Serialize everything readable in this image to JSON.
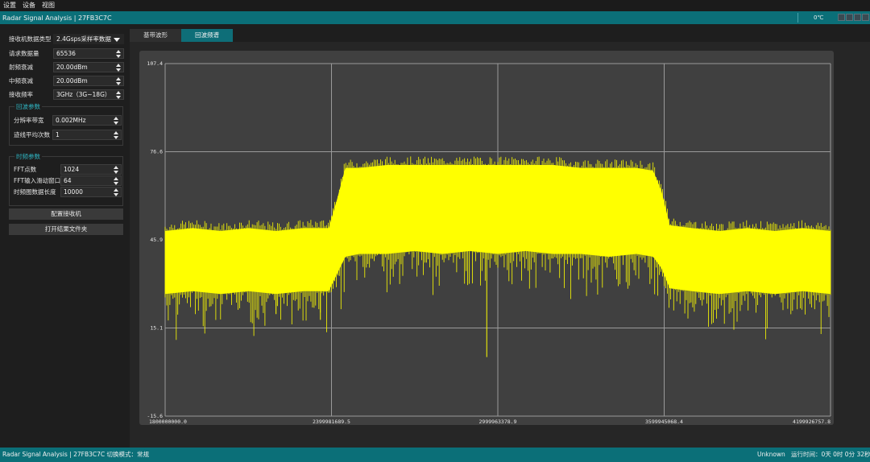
{
  "menubar": {
    "items": [
      "设置",
      "设备",
      "视图"
    ]
  },
  "titlebar": {
    "title": "Radar Signal Analysis | 27FB3C7C",
    "temp": "0℃"
  },
  "left": {
    "data_type": {
      "label": "接收机数据类型",
      "value": "2.4Gsps采样率数据"
    },
    "req_count": {
      "label": "请求数据量",
      "value": "65536"
    },
    "rf_atten": {
      "label": "射频衰减",
      "value": "20.00dBm"
    },
    "if_atten": {
      "label": "中频衰减",
      "value": "20.00dBm"
    },
    "rx_freq": {
      "label": "接收频率",
      "value": "3GHz（3G~18G）"
    },
    "echo_group": {
      "title": "回波参数",
      "rbw": {
        "label": "分辨率带宽",
        "value": "0.002MHz"
      },
      "avg": {
        "label": "迹线平均次数",
        "value": "1"
      }
    },
    "tf_group": {
      "title": "时频参数",
      "fft": {
        "label": "FFT点数",
        "value": "1024"
      },
      "win": {
        "label": "FFT输入滑动窗口",
        "value": "64"
      },
      "len": {
        "label": "时频图数据长度",
        "value": "10000"
      }
    },
    "btn_config": "配置接收机",
    "btn_open": "打开结果文件夹"
  },
  "tabs": [
    "基带波形",
    "回波频谱"
  ],
  "chart_data": {
    "type": "line",
    "title": "",
    "xlabel": "",
    "ylabel": "",
    "xlim": [
      1800000000.0,
      4199926757.8
    ],
    "ylim": [
      -15.6,
      107.4
    ],
    "x_ticks": [
      "1800000000.0",
      "2399981689.5",
      "2999963378.9",
      "3599945068.4",
      "4199926757.8"
    ],
    "y_ticks": [
      "107.4",
      "76.6",
      "45.9",
      "15.1",
      "-15.6"
    ],
    "grid": true,
    "color": "#ffff00",
    "series": [
      {
        "x": [
          1800000000,
          1900000000,
          2000000000,
          2100000000,
          2200000000,
          2300000000,
          2390000000,
          2420000000,
          2450000000,
          2500000000,
          2600000000,
          2700000000,
          2800000000,
          2900000000,
          3000000000,
          3100000000,
          3200000000,
          3300000000,
          3400000000,
          3500000000,
          3560000000,
          3590000000,
          3620000000,
          3700000000,
          3800000000,
          3900000000,
          4000000000,
          4100000000,
          4199926757.8
        ],
        "y": [
          44,
          45,
          44,
          45,
          44,
          45,
          45,
          52,
          62,
          63,
          64,
          65,
          66,
          65,
          66,
          65,
          65,
          64,
          65,
          63,
          62,
          55,
          46,
          45,
          44,
          45,
          44,
          45,
          44
        ],
        "y_low": [
          27,
          28,
          27,
          28,
          27,
          28,
          28,
          34,
          40,
          41,
          41,
          42,
          41,
          42,
          41,
          42,
          41,
          41,
          40,
          41,
          40,
          36,
          29,
          28,
          27,
          28,
          27,
          28,
          27
        ],
        "y_high": [
          49,
          50,
          49,
          50,
          49,
          50,
          50,
          60,
          71,
          71,
          72,
          72,
          72,
          72,
          72,
          72,
          72,
          71,
          71,
          71,
          70,
          63,
          51,
          50,
          49,
          50,
          49,
          50,
          49
        ]
      }
    ]
  },
  "status": {
    "left": "Radar Signal Analysis | 27FB3C7C 切换模式：常规",
    "unknown": "Unknown",
    "runtime": "运行时间：0天 0时 0分 32秒"
  }
}
